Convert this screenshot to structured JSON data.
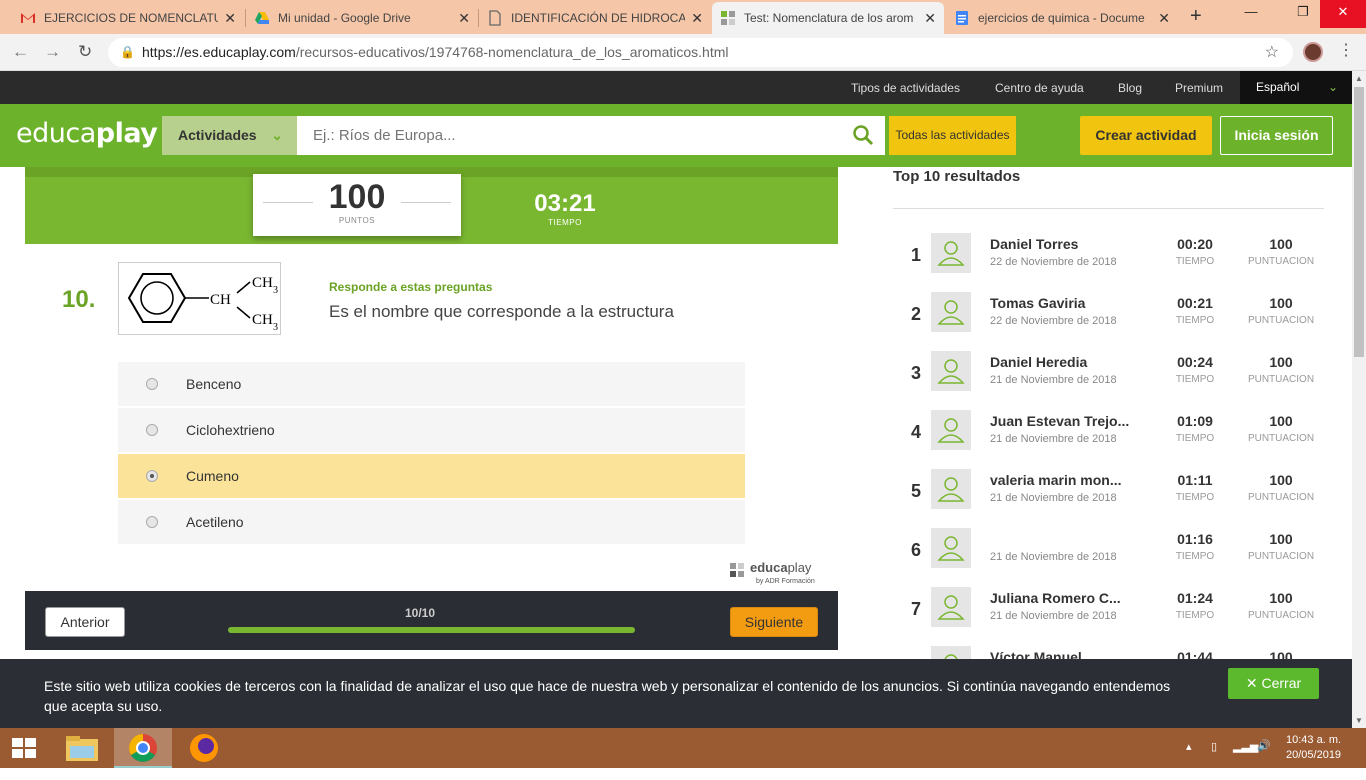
{
  "browser": {
    "tabs": [
      {
        "title": "EJERCICIOS DE NOMENCLATUR",
        "favicon": "gmail-icon",
        "color": "#d93025"
      },
      {
        "title": "Mi unidad - Google Drive",
        "favicon": "drive-icon",
        "color": "#1fa463"
      },
      {
        "title": "IDENTIFICACIÓN DE HIDROCAR",
        "favicon": "document-icon",
        "color": "#666666"
      },
      {
        "title": "Test: Nomenclatura de los arom",
        "favicon": "educaplay-icon",
        "color": "#7ab731"
      },
      {
        "title": "ejercicios de quimica - Docume",
        "favicon": "docs-icon",
        "color": "#4285f4"
      }
    ],
    "url_host": "https://es.educaplay.com",
    "url_path": "/recursos-educativos/1974768-nomenclatura_de_los_aromaticos.html"
  },
  "topnav": {
    "links": [
      "Tipos de actividades",
      "Centro de ayuda",
      "Blog",
      "Premium"
    ],
    "language": "Español"
  },
  "header": {
    "logo_a": "educa",
    "logo_b": "play",
    "activities": "Actividades",
    "search_placeholder": "Ej.: Ríos de Europa...",
    "all_activities": "Todas las actividades",
    "create": "Crear actividad",
    "login": "Inicia sesión"
  },
  "game": {
    "points": "100",
    "points_label": "PUNTOS",
    "time": "03:21",
    "time_label": "TIEMPO",
    "question_number": "10.",
    "structure_labels": {
      "ch": "CH",
      "ch3": "CH",
      "sub3": "3"
    },
    "hint": "Responde a estas preguntas",
    "question": "Es el nombre que corresponde a la estructura",
    "options": [
      {
        "label": "Benceno",
        "selected": false
      },
      {
        "label": "Ciclohextrieno",
        "selected": false
      },
      {
        "label": "Cumeno",
        "selected": true
      },
      {
        "label": "Acetileno",
        "selected": false
      }
    ],
    "brand_a": "educa",
    "brand_b": "play",
    "brand_sub": "by ADR Formación",
    "prev": "Anterior",
    "next": "Siguiente",
    "progress_label": "10/10",
    "progress_fraction": 1.0
  },
  "ranking": {
    "title": "Top 10 resultados",
    "time_label": "TIEMPO",
    "score_label": "PUNTUACION",
    "rows": [
      {
        "pos": "1",
        "name": "Daniel Torres",
        "date": "22 de Noviembre de 2018",
        "time": "00:20",
        "score": "100"
      },
      {
        "pos": "2",
        "name": "Tomas Gaviria",
        "date": "22 de Noviembre de 2018",
        "time": "00:21",
        "score": "100"
      },
      {
        "pos": "3",
        "name": "Daniel Heredia",
        "date": "21 de Noviembre de 2018",
        "time": "00:24",
        "score": "100"
      },
      {
        "pos": "4",
        "name": "Juan Estevan Trejo...",
        "date": "21 de Noviembre de 2018",
        "time": "01:09",
        "score": "100"
      },
      {
        "pos": "5",
        "name": "valeria marin mon...",
        "date": "21 de Noviembre de 2018",
        "time": "01:11",
        "score": "100"
      },
      {
        "pos": "6",
        "name": "",
        "date": "21 de Noviembre de 2018",
        "time": "01:16",
        "score": "100"
      },
      {
        "pos": "7",
        "name": "Juliana Romero C...",
        "date": "21 de Noviembre de 2018",
        "time": "01:24",
        "score": "100"
      },
      {
        "pos": "8",
        "name": "Víctor Manuel",
        "date": "",
        "time": "01:44",
        "score": "100"
      }
    ]
  },
  "cookie": {
    "text": "Este sitio web utiliza cookies de terceros con la finalidad de analizar el uso que hace de nuestra web y personalizar el contenido de los anuncios. Si continúa navegando entendemos que acepta su uso.",
    "close": "Cerrar"
  },
  "taskbar": {
    "time": "10:43 a. m.",
    "date": "20/05/2019"
  }
}
